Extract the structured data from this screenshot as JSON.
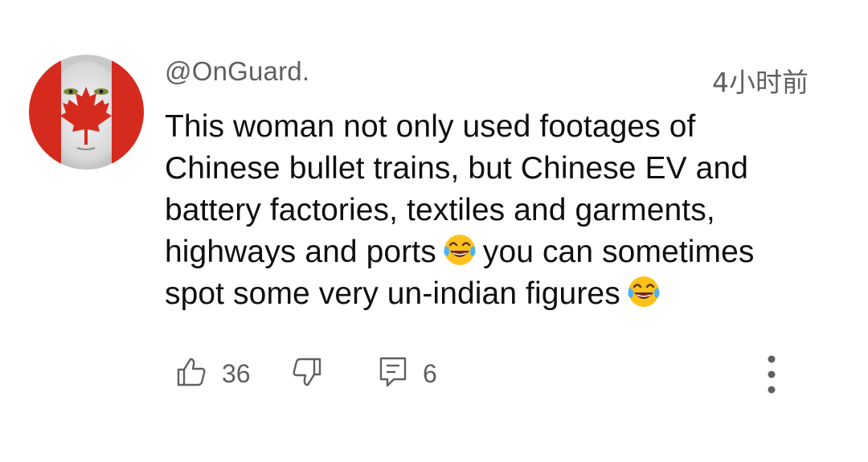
{
  "comment": {
    "author": "@OnGuard.",
    "timestamp": "4小时前",
    "text_lines": [
      {
        "before": "This woman not only used footages of",
        "emoji": "",
        "after": ""
      },
      {
        "before": "Chinese bullet trains, but Chinese EV and",
        "emoji": "",
        "after": ""
      },
      {
        "before": "battery factories, textiles and garments,",
        "emoji": "",
        "after": ""
      },
      {
        "before": "highways and ports",
        "emoji": "face-with-tears-of-joy",
        "after": "you can sometimes"
      },
      {
        "before": "spot some very un-indian figures",
        "emoji": "face-with-tears-of-joy",
        "after": ""
      }
    ],
    "likes": "36",
    "replies": "6"
  },
  "icons": {
    "avatar": "canada-flag-face-avatar",
    "like": "thumbs-up-icon",
    "dislike": "thumbs-down-icon",
    "reply": "reply-comment-icon",
    "more": "more-vertical-icon"
  },
  "colors": {
    "text": "#0f0f0f",
    "secondary": "#606060",
    "flag_red": "#d52b1e"
  }
}
